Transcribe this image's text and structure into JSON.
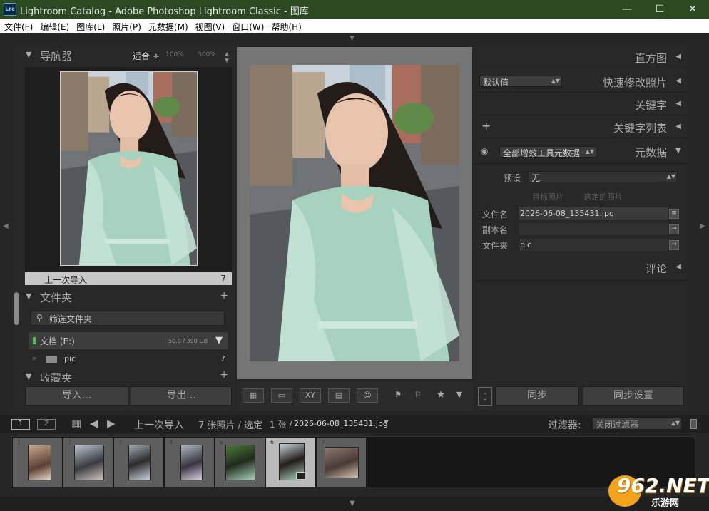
{
  "window": {
    "title": "Lightroom Catalog - Adobe Photoshop Lightroom Classic - 图库",
    "app_icon": "Lrc",
    "minimize": "—",
    "maximize": "☐",
    "close": "✕"
  },
  "menu": [
    "文件(F)",
    "编辑(E)",
    "图库(L)",
    "照片(P)",
    "元数据(M)",
    "视图(V)",
    "窗口(W)",
    "帮助(H)"
  ],
  "left": {
    "navigator": {
      "title": "导航器",
      "fit": "适合",
      "zoom1": "100%",
      "zoom2": "300%"
    },
    "source": {
      "label": "上一次导入",
      "count": "7"
    },
    "folders": {
      "title": "文件夹",
      "filter_placeholder": "筛选文件夹",
      "volume_name": "文档 (E:)",
      "volume_size": "50.0 / 390 GB",
      "folder_name": "pic",
      "folder_count": "7"
    },
    "collections": {
      "title": "收藏夹"
    },
    "import_button": "导入...",
    "export_button": "导出..."
  },
  "right": {
    "histogram": "直方图",
    "quick_develop": "快速修改照片",
    "quick_preset": "默认值",
    "keywording": "关键字",
    "keyword_list": "关键字列表",
    "metadata": "元数据",
    "metadata_preset": "全部增效工具元数据",
    "preset_label": "预设",
    "preset_value": "无",
    "target_photo": "目标照片",
    "selected_photos": "选定的照片",
    "fields": [
      {
        "label": "文件名",
        "value": "2026-06-08_135431.jpg"
      },
      {
        "label": "副本名",
        "value": ""
      },
      {
        "label": "文件夹",
        "value": "pic"
      }
    ],
    "comments": "评论",
    "sync_button": "同步",
    "sync_settings_button": "同步设置"
  },
  "filmbar": {
    "view1": "1",
    "view2": "2",
    "source": "上一次导入",
    "count": "7 张照片 / 选定",
    "selected": "1 张 /",
    "filename": "2026-06-08_135431.jpg",
    "filter_label": "过滤器:",
    "filter_value": "关闭过滤器"
  },
  "filmstrip": [
    {
      "index": "1"
    },
    {
      "index": "2"
    },
    {
      "index": "3"
    },
    {
      "index": "4"
    },
    {
      "index": "5"
    },
    {
      "index": "6"
    },
    {
      "index": "7"
    }
  ],
  "watermark": {
    "text": "962.NET",
    "subtext": "乐游网"
  },
  "colors": {
    "titlebar": "#2b4a22",
    "panel": "#282828",
    "selected_cell": "#b9b9b9"
  }
}
